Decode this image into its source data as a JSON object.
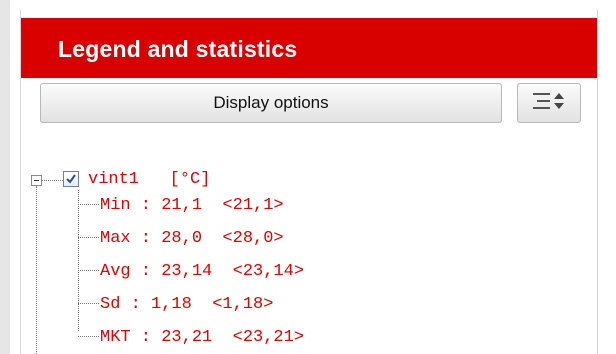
{
  "panel": {
    "title": "Legend and statistics",
    "display_options_label": "Display options",
    "menu_icon": "sort-options-icon"
  },
  "series": {
    "name": "vint1",
    "unit": "[°C]",
    "checked": true,
    "stats": [
      {
        "label": "Min : 21,1  <21,1>"
      },
      {
        "label": "Max : 28,0  <28,0>"
      },
      {
        "label": "Avg : 23,14  <23,14>"
      },
      {
        "label": "Sd : 1,18  <1,18>"
      },
      {
        "label": "MKT : 23,21  <23,21>"
      }
    ]
  },
  "colors": {
    "header_bg": "#d90000",
    "series_text": "#e00000"
  }
}
